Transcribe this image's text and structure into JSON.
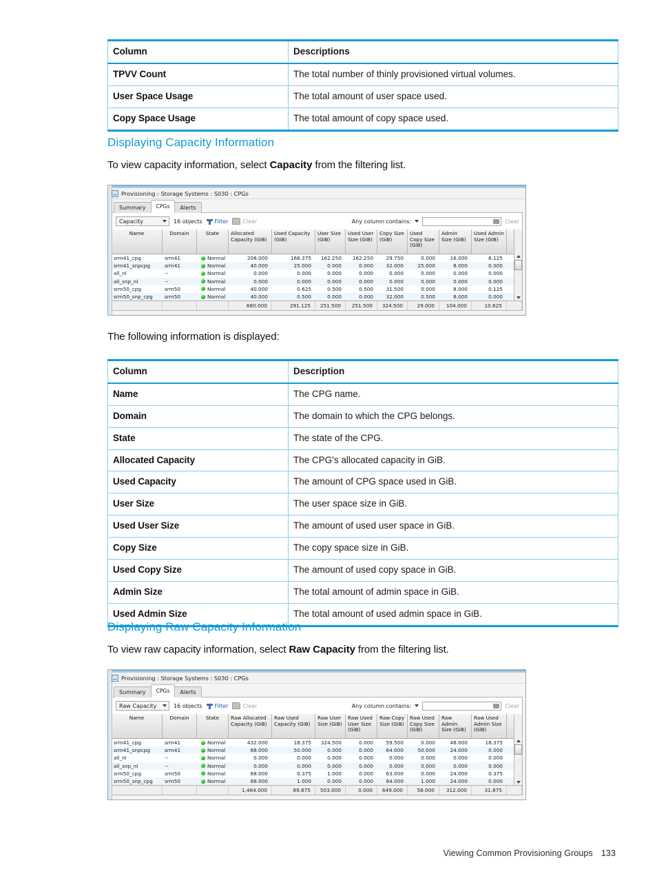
{
  "top_table": {
    "headers": [
      "Column",
      "Descriptions"
    ],
    "rows": [
      [
        "TPVV Count",
        "The total number of thinly provisioned virtual volumes."
      ],
      [
        "User Space Usage",
        "The total amount of user space used."
      ],
      [
        "Copy Space Usage",
        "The total amount of copy space used."
      ]
    ]
  },
  "section1": {
    "heading": "Displaying Capacity Information",
    "para_before": "To view capacity information, select ",
    "para_bold": "Capacity",
    "para_after": " from the filtering list."
  },
  "para_following": "The following information is displayed:",
  "mid_table": {
    "headers": [
      "Column",
      "Description"
    ],
    "rows": [
      [
        "Name",
        "The CPG name."
      ],
      [
        "Domain",
        "The domain to which the CPG belongs."
      ],
      [
        "State",
        "The state of the CPG."
      ],
      [
        "Allocated Capacity",
        "The CPG's allocated capacity in GiB."
      ],
      [
        "Used Capacity",
        "The amount of CPG space used in GiB."
      ],
      [
        "User Size",
        "The user space size in GiB."
      ],
      [
        "Used User Size",
        "The amount of used user space in GiB."
      ],
      [
        "Copy Size",
        "The copy space size in GiB."
      ],
      [
        "Used Copy Size",
        "The amount of used copy space in GiB."
      ],
      [
        "Admin Size",
        "The total amount of admin space in GiB."
      ],
      [
        "Used Admin Size",
        "The total amount of used admin space in GiB."
      ]
    ]
  },
  "section2": {
    "heading": "Displaying Raw Capacity Information",
    "para_before": "To view raw capacity information, select ",
    "para_bold": "Raw Capacity",
    "para_after": " from the filtering list."
  },
  "screenshot1": {
    "window_title": "Provisioning : Storage Systems : S030 : CPGs",
    "tabs": [
      "Summary",
      "CPGs",
      "Alerts"
    ],
    "active_tab": "CPGs",
    "toolbar": {
      "filter_select": "Capacity",
      "object_count": "16 objects",
      "filter_label": "Filter",
      "clear_label": "Clear",
      "contains_label": "Any column contains:",
      "search_value": "",
      "search_clear_label": "Clear"
    },
    "columns": [
      "Name",
      "Domain",
      "State",
      "Allocated Capacity (GiB)",
      "Used Capacity (GiB)",
      "User Size (GiB)",
      "Used User Size (GiB)",
      "Copy Size (GiB)",
      "Used Copy Size (GiB)",
      "Admin Size (GiB)",
      "Used Admin Size (GiB)"
    ],
    "rows": [
      [
        "srm41_cpg",
        "srm41",
        "Normal",
        "208.000",
        "168.375",
        "162.250",
        "162.250",
        "29.750",
        "0.000",
        "16.000",
        "6.125"
      ],
      [
        "srm41_snpcpg",
        "srm41",
        "Normal",
        "40.000",
        "25.000",
        "0.000",
        "0.000",
        "32.000",
        "25.000",
        "8.000",
        "0.000"
      ],
      [
        "all_nl",
        "--",
        "Normal",
        "0.000",
        "0.000",
        "0.000",
        "0.000",
        "0.000",
        "0.000",
        "0.000",
        "0.000"
      ],
      [
        "all_snp_nl",
        "--",
        "Normal",
        "0.000",
        "0.000",
        "0.000",
        "0.000",
        "0.000",
        "0.000",
        "0.000",
        "0.000"
      ],
      [
        "srm50_cpg",
        "srm50",
        "Normal",
        "40.000",
        "0.625",
        "0.500",
        "0.500",
        "31.500",
        "0.000",
        "8.000",
        "0.125"
      ],
      [
        "srm50_snp_cpg",
        "srm50",
        "Normal",
        "40.000",
        "0.500",
        "0.000",
        "0.000",
        "32.000",
        "0.500",
        "8.000",
        "0.000"
      ]
    ],
    "totals": [
      "",
      "",
      "",
      "680.000",
      "291.125",
      "251.500",
      "251.500",
      "324.500",
      "29.000",
      "104.000",
      "10.625"
    ]
  },
  "screenshot2": {
    "window_title": "Provisioning : Storage Systems : S030 : CPGs",
    "tabs": [
      "Summary",
      "CPGs",
      "Alerts"
    ],
    "active_tab": "CPGs",
    "toolbar": {
      "filter_select": "Raw Capacity",
      "object_count": "16 objects",
      "filter_label": "Filter",
      "clear_label": "Clear",
      "contains_label": "Any column contains:",
      "search_value": "",
      "search_clear_label": "Clear"
    },
    "columns": [
      "Name",
      "Domain",
      "State",
      "Raw Allocated Capacity (GiB)",
      "Raw Used Capacity (GiB)",
      "Raw User Size (GiB)",
      "Raw Used User Size (GiB)",
      "Raw Copy Size (GiB)",
      "Raw Used Copy Size (GiB)",
      "Raw Admin Size (GiB)",
      "Raw Used Admin Size (GiB)"
    ],
    "rows": [
      [
        "srm41_cpg",
        "srm41",
        "Normal",
        "432.000",
        "18.375",
        "324.500",
        "0.000",
        "59.500",
        "0.000",
        "48.000",
        "18.375"
      ],
      [
        "srm41_snpcpg",
        "srm41",
        "Normal",
        "88.000",
        "50.000",
        "0.000",
        "0.000",
        "64.000",
        "50.000",
        "24.000",
        "0.000"
      ],
      [
        "all_nl",
        "--",
        "Normal",
        "0.000",
        "0.000",
        "0.000",
        "0.000",
        "0.000",
        "0.000",
        "0.000",
        "0.000"
      ],
      [
        "all_snp_nl",
        "--",
        "Normal",
        "0.000",
        "0.000",
        "0.000",
        "0.000",
        "0.000",
        "0.000",
        "0.000",
        "0.000"
      ],
      [
        "srm50_cpg",
        "srm50",
        "Normal",
        "88.000",
        "0.375",
        "1.000",
        "0.000",
        "63.000",
        "0.000",
        "24.000",
        "0.375"
      ],
      [
        "srm50_snp_cpg",
        "srm50",
        "Normal",
        "88.000",
        "1.000",
        "0.000",
        "0.000",
        "64.000",
        "1.000",
        "24.000",
        "0.000"
      ]
    ],
    "totals": [
      "",
      "",
      "",
      "1,464.000",
      "89.875",
      "503.000",
      "0.000",
      "649.000",
      "58.000",
      "312.000",
      "31.875"
    ]
  },
  "footer": {
    "chapter": "Viewing Common Provisioning Groups",
    "page_number": "133"
  },
  "colors": {
    "accent": "#0e9bd8",
    "heading": "#0e9bd8",
    "status_ok": "#13b313",
    "link": "#1858a8"
  }
}
